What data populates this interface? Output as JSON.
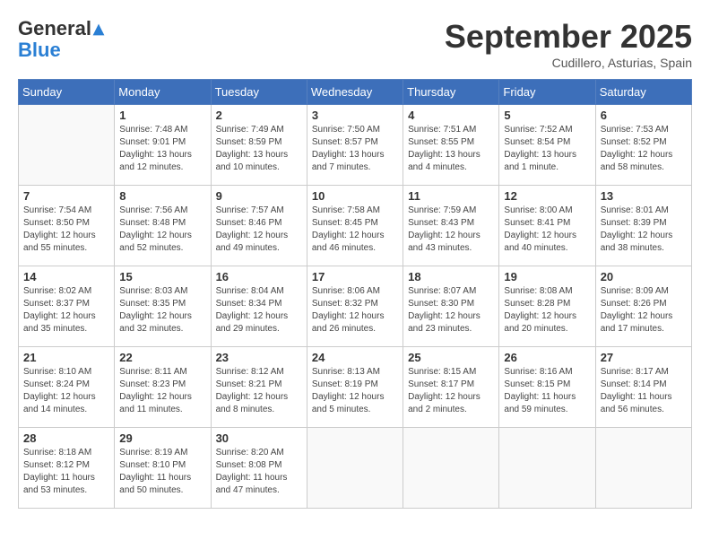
{
  "logo": {
    "line1": "General",
    "line2": "Blue"
  },
  "title": "September 2025",
  "subtitle": "Cudillero, Asturias, Spain",
  "days_of_week": [
    "Sunday",
    "Monday",
    "Tuesday",
    "Wednesday",
    "Thursday",
    "Friday",
    "Saturday"
  ],
  "weeks": [
    [
      {
        "num": "",
        "sunrise": "",
        "sunset": "",
        "daylight": ""
      },
      {
        "num": "1",
        "sunrise": "Sunrise: 7:48 AM",
        "sunset": "Sunset: 9:01 PM",
        "daylight": "Daylight: 13 hours and 12 minutes."
      },
      {
        "num": "2",
        "sunrise": "Sunrise: 7:49 AM",
        "sunset": "Sunset: 8:59 PM",
        "daylight": "Daylight: 13 hours and 10 minutes."
      },
      {
        "num": "3",
        "sunrise": "Sunrise: 7:50 AM",
        "sunset": "Sunset: 8:57 PM",
        "daylight": "Daylight: 13 hours and 7 minutes."
      },
      {
        "num": "4",
        "sunrise": "Sunrise: 7:51 AM",
        "sunset": "Sunset: 8:55 PM",
        "daylight": "Daylight: 13 hours and 4 minutes."
      },
      {
        "num": "5",
        "sunrise": "Sunrise: 7:52 AM",
        "sunset": "Sunset: 8:54 PM",
        "daylight": "Daylight: 13 hours and 1 minute."
      },
      {
        "num": "6",
        "sunrise": "Sunrise: 7:53 AM",
        "sunset": "Sunset: 8:52 PM",
        "daylight": "Daylight: 12 hours and 58 minutes."
      }
    ],
    [
      {
        "num": "7",
        "sunrise": "Sunrise: 7:54 AM",
        "sunset": "Sunset: 8:50 PM",
        "daylight": "Daylight: 12 hours and 55 minutes."
      },
      {
        "num": "8",
        "sunrise": "Sunrise: 7:56 AM",
        "sunset": "Sunset: 8:48 PM",
        "daylight": "Daylight: 12 hours and 52 minutes."
      },
      {
        "num": "9",
        "sunrise": "Sunrise: 7:57 AM",
        "sunset": "Sunset: 8:46 PM",
        "daylight": "Daylight: 12 hours and 49 minutes."
      },
      {
        "num": "10",
        "sunrise": "Sunrise: 7:58 AM",
        "sunset": "Sunset: 8:45 PM",
        "daylight": "Daylight: 12 hours and 46 minutes."
      },
      {
        "num": "11",
        "sunrise": "Sunrise: 7:59 AM",
        "sunset": "Sunset: 8:43 PM",
        "daylight": "Daylight: 12 hours and 43 minutes."
      },
      {
        "num": "12",
        "sunrise": "Sunrise: 8:00 AM",
        "sunset": "Sunset: 8:41 PM",
        "daylight": "Daylight: 12 hours and 40 minutes."
      },
      {
        "num": "13",
        "sunrise": "Sunrise: 8:01 AM",
        "sunset": "Sunset: 8:39 PM",
        "daylight": "Daylight: 12 hours and 38 minutes."
      }
    ],
    [
      {
        "num": "14",
        "sunrise": "Sunrise: 8:02 AM",
        "sunset": "Sunset: 8:37 PM",
        "daylight": "Daylight: 12 hours and 35 minutes."
      },
      {
        "num": "15",
        "sunrise": "Sunrise: 8:03 AM",
        "sunset": "Sunset: 8:35 PM",
        "daylight": "Daylight: 12 hours and 32 minutes."
      },
      {
        "num": "16",
        "sunrise": "Sunrise: 8:04 AM",
        "sunset": "Sunset: 8:34 PM",
        "daylight": "Daylight: 12 hours and 29 minutes."
      },
      {
        "num": "17",
        "sunrise": "Sunrise: 8:06 AM",
        "sunset": "Sunset: 8:32 PM",
        "daylight": "Daylight: 12 hours and 26 minutes."
      },
      {
        "num": "18",
        "sunrise": "Sunrise: 8:07 AM",
        "sunset": "Sunset: 8:30 PM",
        "daylight": "Daylight: 12 hours and 23 minutes."
      },
      {
        "num": "19",
        "sunrise": "Sunrise: 8:08 AM",
        "sunset": "Sunset: 8:28 PM",
        "daylight": "Daylight: 12 hours and 20 minutes."
      },
      {
        "num": "20",
        "sunrise": "Sunrise: 8:09 AM",
        "sunset": "Sunset: 8:26 PM",
        "daylight": "Daylight: 12 hours and 17 minutes."
      }
    ],
    [
      {
        "num": "21",
        "sunrise": "Sunrise: 8:10 AM",
        "sunset": "Sunset: 8:24 PM",
        "daylight": "Daylight: 12 hours and 14 minutes."
      },
      {
        "num": "22",
        "sunrise": "Sunrise: 8:11 AM",
        "sunset": "Sunset: 8:23 PM",
        "daylight": "Daylight: 12 hours and 11 minutes."
      },
      {
        "num": "23",
        "sunrise": "Sunrise: 8:12 AM",
        "sunset": "Sunset: 8:21 PM",
        "daylight": "Daylight: 12 hours and 8 minutes."
      },
      {
        "num": "24",
        "sunrise": "Sunrise: 8:13 AM",
        "sunset": "Sunset: 8:19 PM",
        "daylight": "Daylight: 12 hours and 5 minutes."
      },
      {
        "num": "25",
        "sunrise": "Sunrise: 8:15 AM",
        "sunset": "Sunset: 8:17 PM",
        "daylight": "Daylight: 12 hours and 2 minutes."
      },
      {
        "num": "26",
        "sunrise": "Sunrise: 8:16 AM",
        "sunset": "Sunset: 8:15 PM",
        "daylight": "Daylight: 11 hours and 59 minutes."
      },
      {
        "num": "27",
        "sunrise": "Sunrise: 8:17 AM",
        "sunset": "Sunset: 8:14 PM",
        "daylight": "Daylight: 11 hours and 56 minutes."
      }
    ],
    [
      {
        "num": "28",
        "sunrise": "Sunrise: 8:18 AM",
        "sunset": "Sunset: 8:12 PM",
        "daylight": "Daylight: 11 hours and 53 minutes."
      },
      {
        "num": "29",
        "sunrise": "Sunrise: 8:19 AM",
        "sunset": "Sunset: 8:10 PM",
        "daylight": "Daylight: 11 hours and 50 minutes."
      },
      {
        "num": "30",
        "sunrise": "Sunrise: 8:20 AM",
        "sunset": "Sunset: 8:08 PM",
        "daylight": "Daylight: 11 hours and 47 minutes."
      },
      {
        "num": "",
        "sunrise": "",
        "sunset": "",
        "daylight": ""
      },
      {
        "num": "",
        "sunrise": "",
        "sunset": "",
        "daylight": ""
      },
      {
        "num": "",
        "sunrise": "",
        "sunset": "",
        "daylight": ""
      },
      {
        "num": "",
        "sunrise": "",
        "sunset": "",
        "daylight": ""
      }
    ]
  ]
}
